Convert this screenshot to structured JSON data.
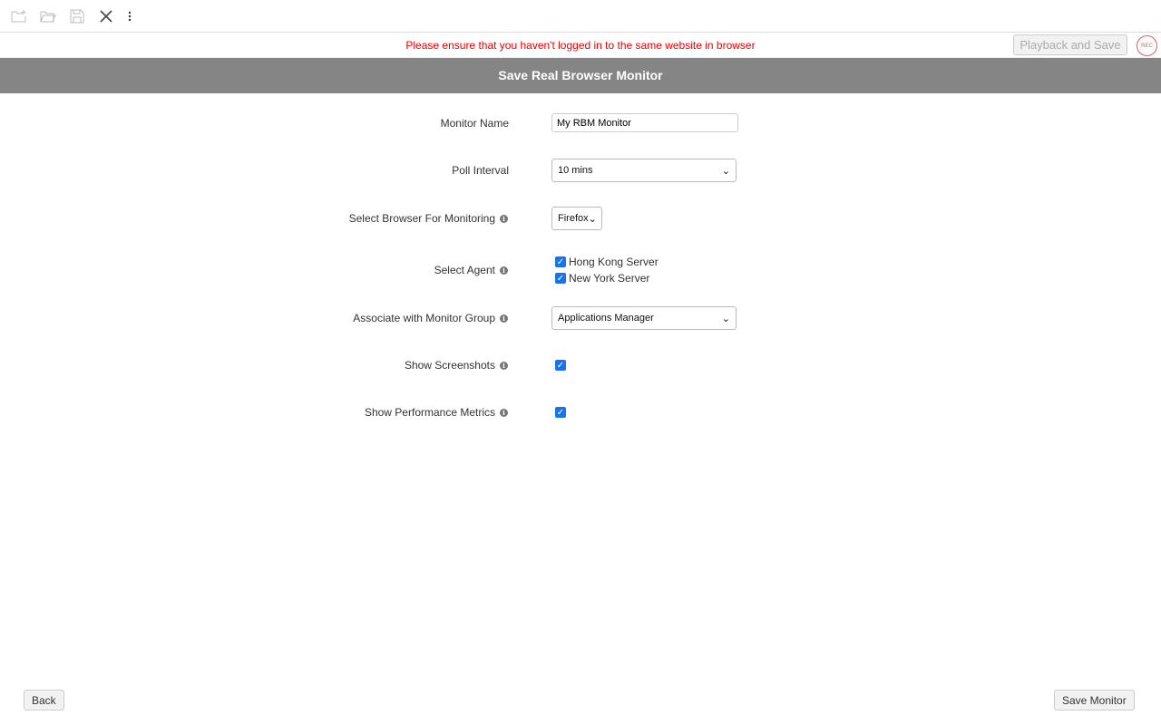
{
  "toolbar": {
    "icons": [
      "new-folder-icon",
      "open-folder-icon",
      "save-icon",
      "close-icon",
      "more-vertical-icon"
    ]
  },
  "warning": "Please ensure that you haven't logged in to the same website in browser",
  "playback_label": "Playback and Save",
  "rec_label": "REC",
  "title": "Save Real Browser Monitor",
  "form": {
    "monitor_name": {
      "label": "Monitor Name",
      "value": "My RBM Monitor"
    },
    "poll_interval": {
      "label": "Poll Interval",
      "value": "10 mins"
    },
    "browser": {
      "label": "Select Browser For Monitoring",
      "value": "Firefox"
    },
    "agent": {
      "label": "Select Agent",
      "options": [
        {
          "label": "Hong Kong Server",
          "checked": true
        },
        {
          "label": "New York Server",
          "checked": true
        }
      ]
    },
    "group": {
      "label": "Associate with Monitor Group",
      "value": "Applications Manager"
    },
    "screenshots": {
      "label": "Show Screenshots",
      "checked": true
    },
    "metrics": {
      "label": "Show Performance Metrics",
      "checked": true
    }
  },
  "back_label": "Back",
  "save_label": "Save Monitor",
  "colors": {
    "accent": "#1a73e8",
    "warning": "#ee0000",
    "header": "#858585"
  }
}
